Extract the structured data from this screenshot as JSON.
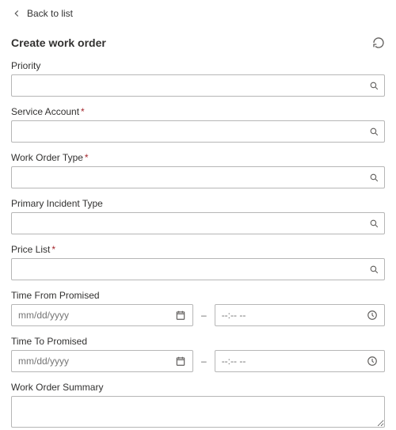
{
  "nav": {
    "back_label": "Back to list"
  },
  "header": {
    "title": "Create work order"
  },
  "fields": {
    "priority": {
      "label": "Priority",
      "required": false,
      "value": ""
    },
    "service_account": {
      "label": "Service Account",
      "required": true,
      "value": ""
    },
    "work_order_type": {
      "label": "Work Order Type",
      "required": true,
      "value": ""
    },
    "primary_incident_type": {
      "label": "Primary Incident Type",
      "required": false,
      "value": ""
    },
    "price_list": {
      "label": "Price List",
      "required": true,
      "value": ""
    },
    "time_from": {
      "label": "Time From Promised",
      "date_placeholder": "mm/dd/yyyy",
      "time_placeholder": "--:-- --",
      "date_value": "",
      "time_value": ""
    },
    "time_to": {
      "label": "Time To Promised",
      "date_placeholder": "mm/dd/yyyy",
      "time_placeholder": "--:-- --",
      "date_value": "",
      "time_value": ""
    },
    "summary": {
      "label": "Work Order Summary",
      "value": ""
    }
  },
  "glyphs": {
    "required_marker": "*",
    "separator": "–"
  }
}
